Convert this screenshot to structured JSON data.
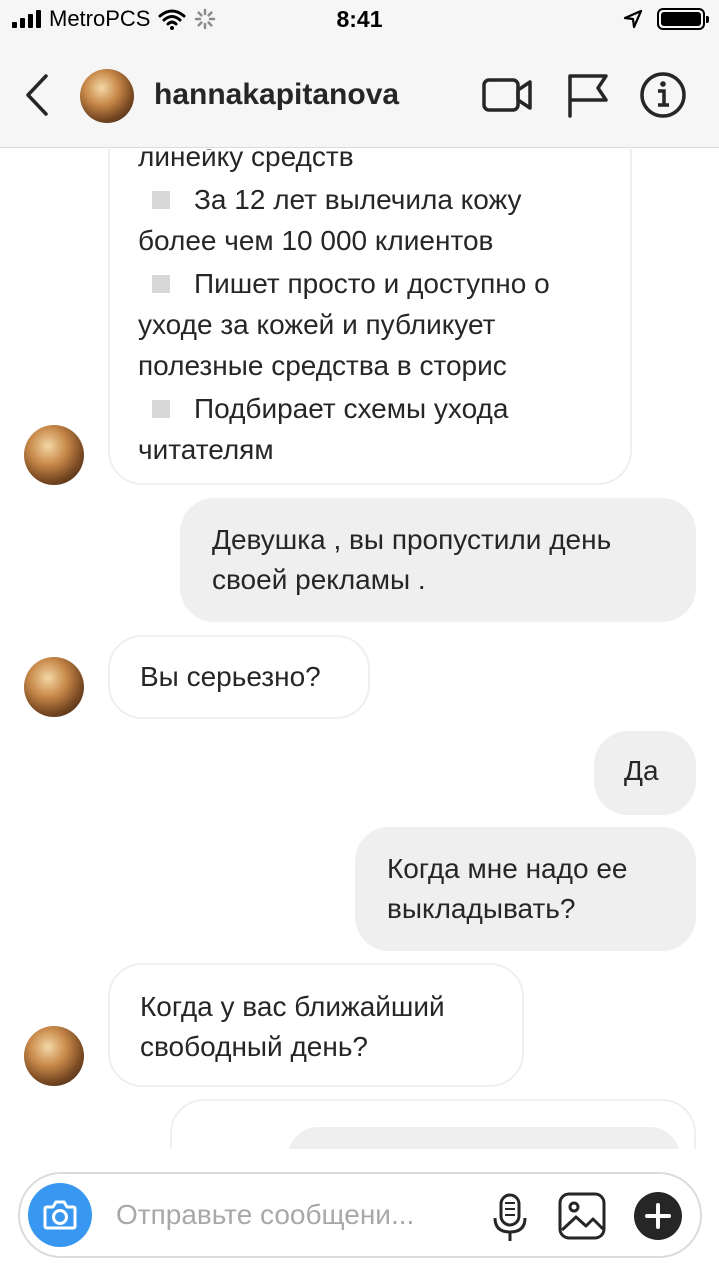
{
  "status_bar": {
    "carrier": "MetroPCS",
    "time": "8:41",
    "battery_level": 1.0
  },
  "header": {
    "username": "hannakapitanova",
    "icons": [
      "back-arrow-icon",
      "video-call-icon",
      "flag-icon",
      "info-icon"
    ]
  },
  "messages": {
    "list_lines": [
      "линейку средств",
      "За 12 лет вылечила кожу",
      "более чем 10 000 клиентов",
      "Пишет просто и доступно о",
      "уходе за кожей и публикует",
      "полезные средства в сторис",
      "Подбирает схемы ухода",
      "читателям"
    ],
    "m1": [
      "Девушка , вы пропустили день",
      "своей рекламы ."
    ],
    "m2": [
      "Вы серьезно?"
    ],
    "m3": [
      "Да"
    ],
    "m4": [
      "Когда мне надо ее",
      "выкладывать?"
    ],
    "m5": [
      "Когда у вас ближайший",
      "свободный день?"
    ]
  },
  "composer": {
    "placeholder": "Отправьте сообщени..."
  },
  "colors": {
    "accent": "#3897f0",
    "outgoing_bubble": "#efefef",
    "text": "#262626"
  }
}
